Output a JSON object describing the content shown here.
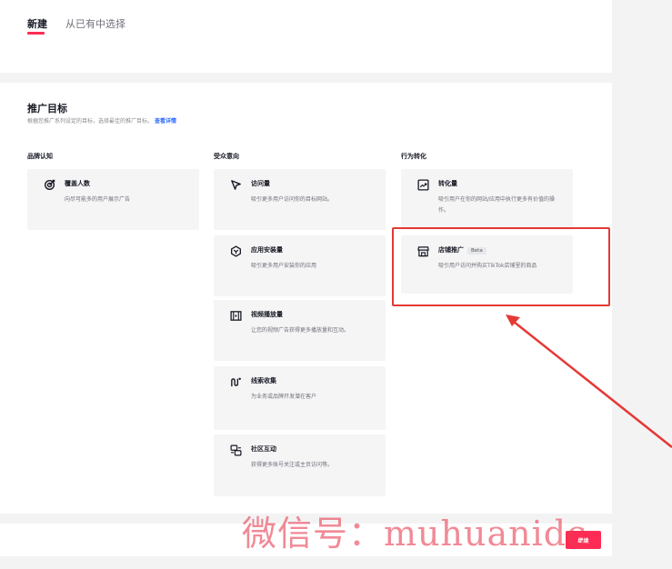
{
  "tabs": {
    "new": "新建",
    "existing": "从已有中选择"
  },
  "goal": {
    "title": "推广目标",
    "description": "根据您推广系列设定的目标，选择最佳的推广目标。",
    "details_link": "查看详情"
  },
  "columns": [
    {
      "title": "品牌认知",
      "cards": [
        {
          "icon": "reach-icon",
          "title": "覆盖人数",
          "desc": "向尽可能多的用户展示广告"
        }
      ]
    },
    {
      "title": "受众意向",
      "cards": [
        {
          "icon": "cursor-icon",
          "title": "访问量",
          "desc": "吸引更多用户访问你的目标网站。"
        },
        {
          "icon": "app-install-icon",
          "title": "应用安装量",
          "desc": "吸引更多用户安装你的应用"
        },
        {
          "icon": "video-icon",
          "title": "视频播放量",
          "desc": "让您的视频广告获得更多播放量和互动。"
        },
        {
          "icon": "lead-icon",
          "title": "线索收集",
          "desc": "为业务或品牌开发潜在客户"
        },
        {
          "icon": "community-icon",
          "title": "社区互动",
          "desc": "获得更多账号关注或主页访问等。"
        }
      ]
    },
    {
      "title": "行为转化",
      "cards": [
        {
          "icon": "conversion-icon",
          "title": "转化量",
          "desc": "吸引用户在你的网站/应用中执行更多有价值的操作。"
        },
        {
          "icon": "shop-icon",
          "title": "店铺推广",
          "badge": "Beta",
          "desc": "吸引用户访问并购买TikTok店铺里的商品"
        }
      ]
    }
  ],
  "footer": {
    "continue_label": "继续"
  },
  "watermark": "微信号：muhuanidc",
  "colors": {
    "accent": "#fe2c55",
    "link": "#2a68ff",
    "annotation": "#e53935"
  }
}
